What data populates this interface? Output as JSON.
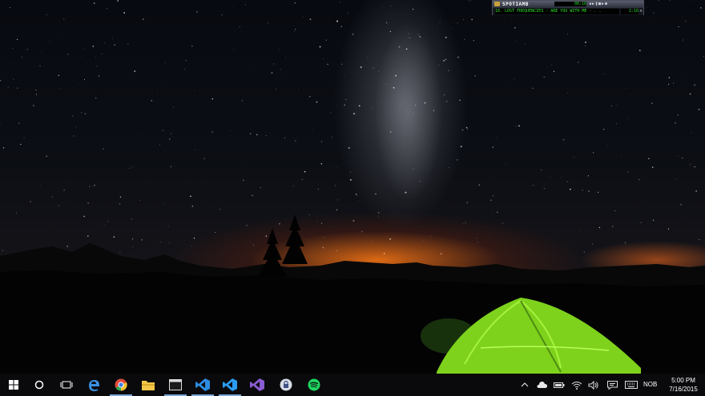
{
  "player": {
    "app_name": "SPOTIAMB",
    "time_display": "00:16",
    "controls": "◀▶❚■▶●",
    "track_ticker": "10. LOST FREQUENCIES - ARE YOU WITH ME - . .",
    "track_position": "2:16",
    "close": "×"
  },
  "taskbar": {
    "apps": [
      {
        "name": "start-button",
        "icon": "windows-logo"
      },
      {
        "name": "cortana-button",
        "icon": "circle"
      },
      {
        "name": "task-view-button",
        "icon": "task-view"
      },
      {
        "name": "edge",
        "icon": "edge-e",
        "color": "#3b8fe0"
      },
      {
        "name": "chrome",
        "icon": "chrome"
      },
      {
        "name": "file-explorer",
        "icon": "folder",
        "color": "#f3c64a"
      },
      {
        "name": "command-prompt",
        "icon": "console"
      },
      {
        "name": "vs-code",
        "icon": "visual-studio",
        "color": "#2d8be0"
      },
      {
        "name": "visual-studio-blue",
        "icon": "visual-studio",
        "color": "#2b9cf2"
      },
      {
        "name": "visual-studio-purple",
        "icon": "visual-studio",
        "color": "#8a5cd1"
      },
      {
        "name": "keepass",
        "icon": "lock"
      },
      {
        "name": "spotify",
        "icon": "spotify",
        "color": "#1ed760"
      }
    ],
    "tray": {
      "chevron": "^",
      "lang": "NOB",
      "time": "5:00 PM",
      "date": "7/16/2015"
    }
  },
  "colors": {
    "taskbar_bg": "#0a0a0c",
    "running_indicator": "#7aa6d6",
    "lcd_green": "#2de52d"
  }
}
